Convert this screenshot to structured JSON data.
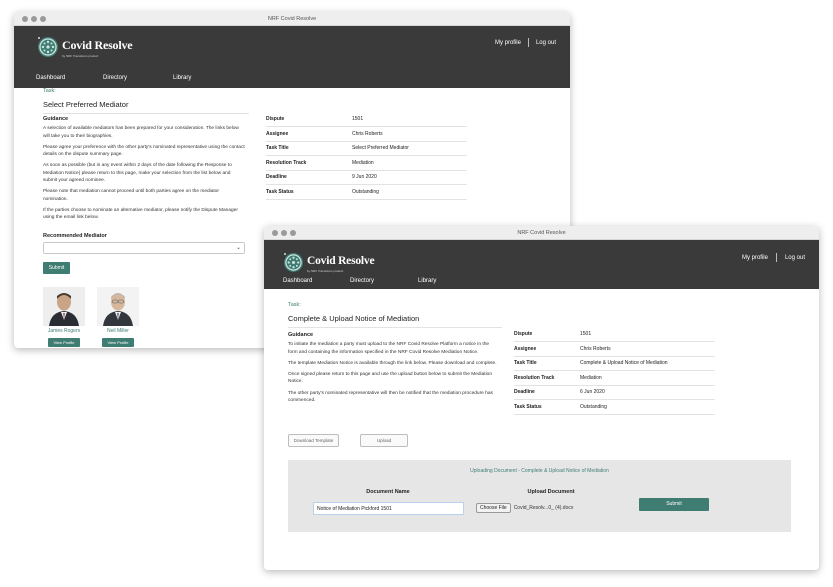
{
  "window_title": "NRF Covid Resolve",
  "brand": {
    "name": "Covid Resolve",
    "tagline": "by NRF Transitions product"
  },
  "topnav": {
    "profile": "My profile",
    "logout": "Log out"
  },
  "mainnav": [
    "Dashboard",
    "Directory",
    "Library"
  ],
  "back": {
    "task_label": "Task:",
    "task_title": "Select Preferred Mediator",
    "guidance_heading": "Guidance",
    "paragraphs": [
      "A selection of available mediators has been prepared for your consideration. The links below will take you to their biographies.",
      "Please agree your preference with the other party's nominated representative using the contact details on the dispute summary page.",
      "As soon as possible (but in any event within 2 days of the date following the Response to Mediation Notice) please return to this page, make your selection from the list below and submit your agreed nominee.",
      "Please note that mediation cannot proceed until both parties agree on the mediator nomination.",
      "If the parties choose to nominate an alternative mediator, please notify the Dispute Manager using the email link below."
    ],
    "recommended_label": "Recommended Mediator",
    "select_value": "",
    "submit": "Submit",
    "mediators": [
      {
        "name": "James Rogers",
        "button": "View Profile"
      },
      {
        "name": "Neil Miller",
        "button": "View Profile"
      }
    ],
    "summary": [
      {
        "k": "Dispute",
        "v": "1501"
      },
      {
        "k": "Assignee",
        "v": "Chris Roberts"
      },
      {
        "k": "Task Title",
        "v": "Select Preferred Mediator"
      },
      {
        "k": "Resolution Track",
        "v": "Mediation"
      },
      {
        "k": "Deadline",
        "v": "9 Jun 2020"
      },
      {
        "k": "Task Status",
        "v": "Outstanding"
      }
    ]
  },
  "front": {
    "task_label": "Task:",
    "task_title": "Complete & Upload Notice of Mediation",
    "guidance_heading": "Guidance",
    "paragraphs": [
      "To initiate the mediation a party must upload to the NRF Covid Resolve Platform a notice in the form and containing the information specified in the NRF Covid Resolve Mediation Notice.",
      "The template Mediation Notice is available through the link below. Please download and complete.",
      "Once signed please return to this page and use the upload button below to submit the Mediation Notice.",
      "The other party's nominated representative will then be notified that the mediation procedure has commenced."
    ],
    "download_button": "Download Template",
    "upload_button": "Upload",
    "upload_panel": {
      "heading": "Uploading Document - Complete & Upload Notice of Mediation",
      "doc_name_label": "Document Name",
      "doc_name_value": "Notice of Mediation Pickford 1501",
      "upload_doc_label": "Upload Document",
      "choose_file": "Choose File",
      "file_name": "Covid_Resolv...0_ (4).docx",
      "submit": "Submit"
    },
    "summary": [
      {
        "k": "Dispute",
        "v": "1501"
      },
      {
        "k": "Assignee",
        "v": "Chris Roberts"
      },
      {
        "k": "Task Title",
        "v": "Complete & Upload Notice of Mediation"
      },
      {
        "k": "Resolution Track",
        "v": "Mediation"
      },
      {
        "k": "Deadline",
        "v": "6 Jun 2020"
      },
      {
        "k": "Task Status",
        "v": "Outstanding"
      }
    ]
  },
  "colors": {
    "header": "#3a3a3a",
    "accent": "#3f7d73",
    "panel": "#e6e6e6"
  }
}
